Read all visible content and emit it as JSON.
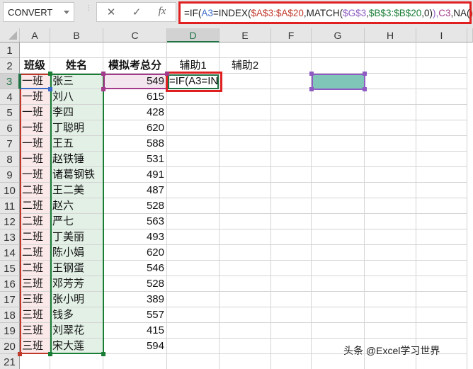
{
  "toolbar": {
    "name_box": "CONVERT",
    "cancel_icon": "✕",
    "enter_icon": "✓",
    "fx_label": "fx",
    "formula": {
      "p1": "=IF(",
      "p2": "A3",
      "p3": "=INDEX(",
      "p4": "$A$3:$A$20",
      "p5": ",MATCH(",
      "p6": "$G$3",
      "p7": ",",
      "p8": "$B$3:$B$20",
      "p9": ",0)",
      "p10": "),",
      "p11": "C3",
      "p12": ",NA(",
      "p13": "))"
    }
  },
  "columns": [
    "A",
    "B",
    "C",
    "D",
    "E",
    "F",
    "G",
    "H",
    "I"
  ],
  "headers": {
    "class": "班级",
    "name": "姓名",
    "score": "模拟考总分",
    "helper1": "辅助1",
    "helper2": "辅助2"
  },
  "editing_cell": "=IF(A3=IN",
  "rows": [
    {
      "class": "一班",
      "name": "张三",
      "score": "549"
    },
    {
      "class": "一班",
      "name": "刘八",
      "score": "615"
    },
    {
      "class": "一班",
      "name": "李四",
      "score": "428"
    },
    {
      "class": "一班",
      "name": "丁聪明",
      "score": "620"
    },
    {
      "class": "一班",
      "name": "王五",
      "score": "588"
    },
    {
      "class": "一班",
      "name": "赵铁锤",
      "score": "531"
    },
    {
      "class": "一班",
      "name": "诸葛钢铁",
      "score": "491"
    },
    {
      "class": "二班",
      "name": "王二美",
      "score": "487"
    },
    {
      "class": "二班",
      "name": "赵六",
      "score": "528"
    },
    {
      "class": "二班",
      "name": "严七",
      "score": "563"
    },
    {
      "class": "二班",
      "name": "丁美丽",
      "score": "493"
    },
    {
      "class": "二班",
      "name": "陈小娟",
      "score": "620"
    },
    {
      "class": "二班",
      "name": "王钢蛋",
      "score": "546"
    },
    {
      "class": "三班",
      "name": "邓芳芳",
      "score": "528"
    },
    {
      "class": "三班",
      "name": "张小明",
      "score": "389"
    },
    {
      "class": "三班",
      "name": "钱多",
      "score": "557"
    },
    {
      "class": "三班",
      "name": "刘翠花",
      "score": "415"
    },
    {
      "class": "三班",
      "name": "宋大莲",
      "score": "594"
    }
  ],
  "colors": {
    "formula_highlight": "#e02020",
    "ref_a": "#c0392b",
    "ref_b": "#1a7d35",
    "ref_c": "#a33a8c",
    "ref_g": "#8e5bc2",
    "g3_fill": "#80c6b8",
    "active_green": "#217346"
  },
  "watermark": "头条 @Excel学习世界"
}
